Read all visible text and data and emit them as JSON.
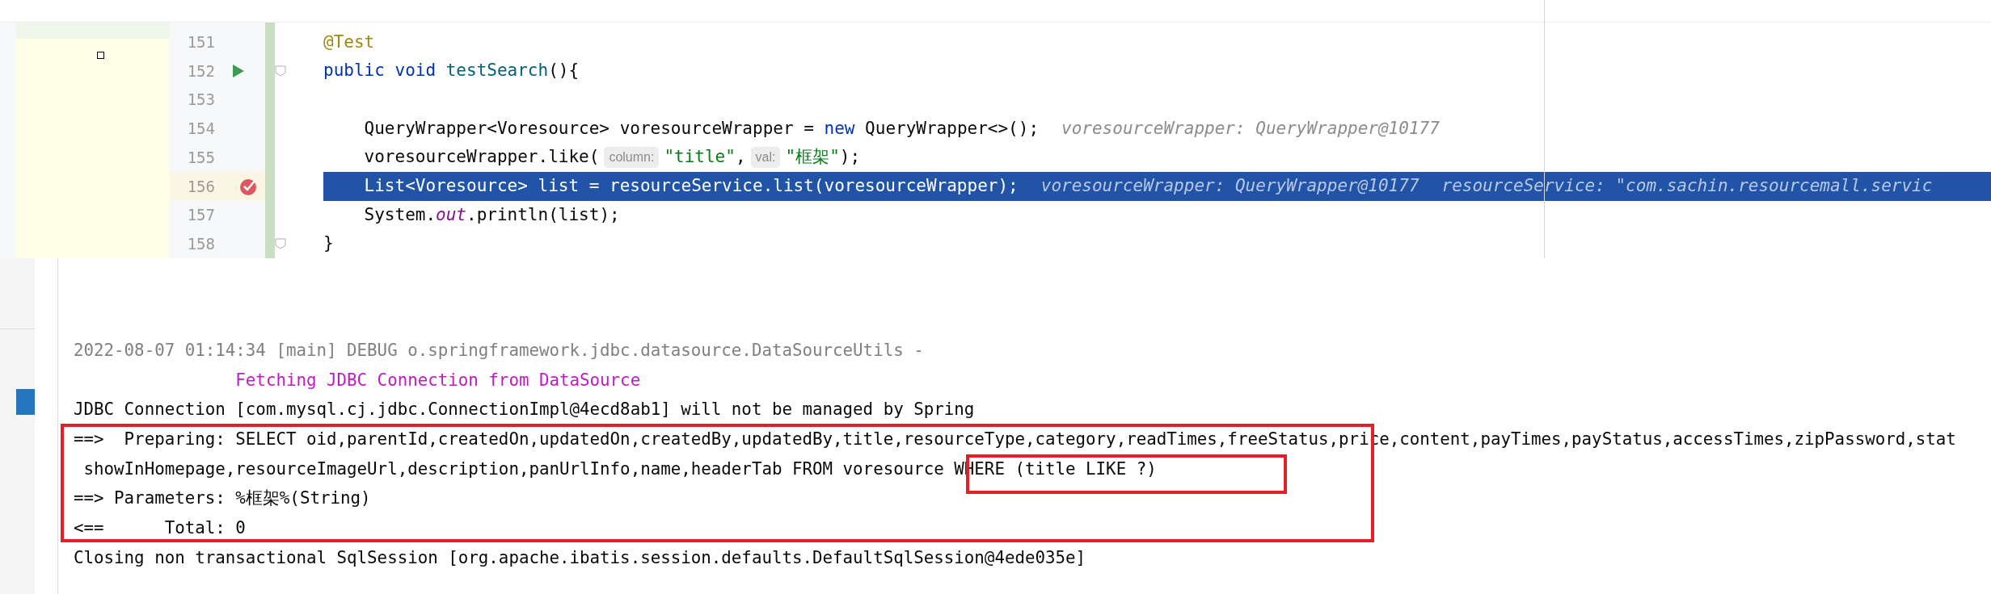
{
  "editor": {
    "lines": [
      {
        "number": "151",
        "run_marker": false,
        "breakpoint": false,
        "highlighted": false,
        "fold": false,
        "segments": [
          {
            "kind": "code",
            "tokens": [
              {
                "kind": "annotation",
                "text": "@Test"
              }
            ]
          }
        ]
      },
      {
        "number": "152",
        "run_marker": true,
        "breakpoint": false,
        "highlighted": false,
        "fold": true,
        "segments": [
          {
            "kind": "code",
            "tokens": [
              {
                "kind": "keyword",
                "text": "public void "
              },
              {
                "kind": "method",
                "text": "testSearch"
              },
              {
                "kind": "plain",
                "text": "(){"
              }
            ]
          }
        ]
      },
      {
        "number": "153",
        "run_marker": false,
        "breakpoint": false,
        "highlighted": false,
        "fold": false
      },
      {
        "number": "154",
        "run_marker": false,
        "breakpoint": false,
        "highlighted": false,
        "fold": false,
        "segments": [
          {
            "kind": "code",
            "tokens": [
              {
                "kind": "plain",
                "text": "    QueryWrapper<Voresource> voresourceWrapper = "
              },
              {
                "kind": "keyword",
                "text": "new "
              },
              {
                "kind": "plain",
                "text": "QueryWrapper<>();"
              }
            ]
          },
          {
            "kind": "value",
            "text": "voresourceWrapper: QueryWrapper@10177"
          }
        ]
      },
      {
        "number": "155",
        "run_marker": false,
        "breakpoint": false,
        "highlighted": false,
        "fold": false,
        "segments": [
          {
            "kind": "code",
            "tokens": [
              {
                "kind": "plain",
                "text": "    voresourceWrapper.like("
              }
            ]
          },
          {
            "kind": "hint",
            "text": "column:"
          },
          {
            "kind": "code",
            "tokens": [
              {
                "kind": "string",
                "text": "\"title\""
              },
              {
                "kind": "plain",
                "text": ","
              }
            ]
          },
          {
            "kind": "hint",
            "text": "val:"
          },
          {
            "kind": "code",
            "tokens": [
              {
                "kind": "string",
                "text": "\"框架\""
              },
              {
                "kind": "plain",
                "text": ");"
              }
            ]
          }
        ]
      },
      {
        "number": "156",
        "run_marker": false,
        "breakpoint": true,
        "highlighted": true,
        "fold": false,
        "segments": [
          {
            "kind": "code",
            "tokens": [
              {
                "kind": "plain",
                "text": "    List<Voresource> list = resourceService.list(voresourceWrapper);"
              }
            ]
          },
          {
            "kind": "value",
            "text": "voresourceWrapper: QueryWrapper@10177"
          },
          {
            "kind": "value",
            "text": "resourceService: \"com.sachin.resourcemall.servic"
          }
        ]
      },
      {
        "number": "157",
        "run_marker": false,
        "breakpoint": false,
        "highlighted": false,
        "fold": false,
        "segments": [
          {
            "kind": "code",
            "tokens": [
              {
                "kind": "plain",
                "text": "    System."
              },
              {
                "kind": "static",
                "text": "out"
              },
              {
                "kind": "plain",
                "text": ".println(list);"
              }
            ]
          }
        ]
      },
      {
        "number": "158",
        "run_marker": false,
        "breakpoint": false,
        "highlighted": false,
        "fold": true,
        "segments": [
          {
            "kind": "code",
            "tokens": [
              {
                "kind": "plain",
                "text": "}"
              }
            ]
          }
        ]
      }
    ]
  },
  "console": {
    "lines": [
      {
        "kind": "log",
        "text": "2022-08-07 01:14:34 [main] DEBUG o.springframework.jdbc.datasource.DataSourceUtils -"
      },
      {
        "kind": "accent",
        "text": "                Fetching JDBC Connection from DataSource"
      },
      {
        "kind": "plain",
        "text": "JDBC Connection [com.mysql.cj.jdbc.ConnectionImpl@4ecd8ab1] will not be managed by Spring"
      },
      {
        "kind": "plain",
        "text": "==>  Preparing: SELECT oid,parentId,createdOn,updatedOn,createdBy,updatedBy,title,resourceType,category,readTimes,freeStatus,price,content,payTimes,payStatus,accessTimes,zipPassword,stat"
      },
      {
        "kind": "plain",
        "text": " showInHomepage,resourceImageUrl,description,panUrlInfo,name,headerTab FROM voresource WHERE (title LIKE ?)"
      },
      {
        "kind": "plain",
        "text": "==> Parameters: %框架%(String)"
      },
      {
        "kind": "plain",
        "text": "<==      Total: 0"
      },
      {
        "kind": "plain",
        "text": "Closing non transactional SqlSession [org.apache.ibatis.session.defaults.DefaultSqlSession@4ede035e]"
      }
    ]
  },
  "annotation_frames": [
    {
      "kind": "rectangle"
    },
    {
      "kind": "rectangle"
    }
  ]
}
